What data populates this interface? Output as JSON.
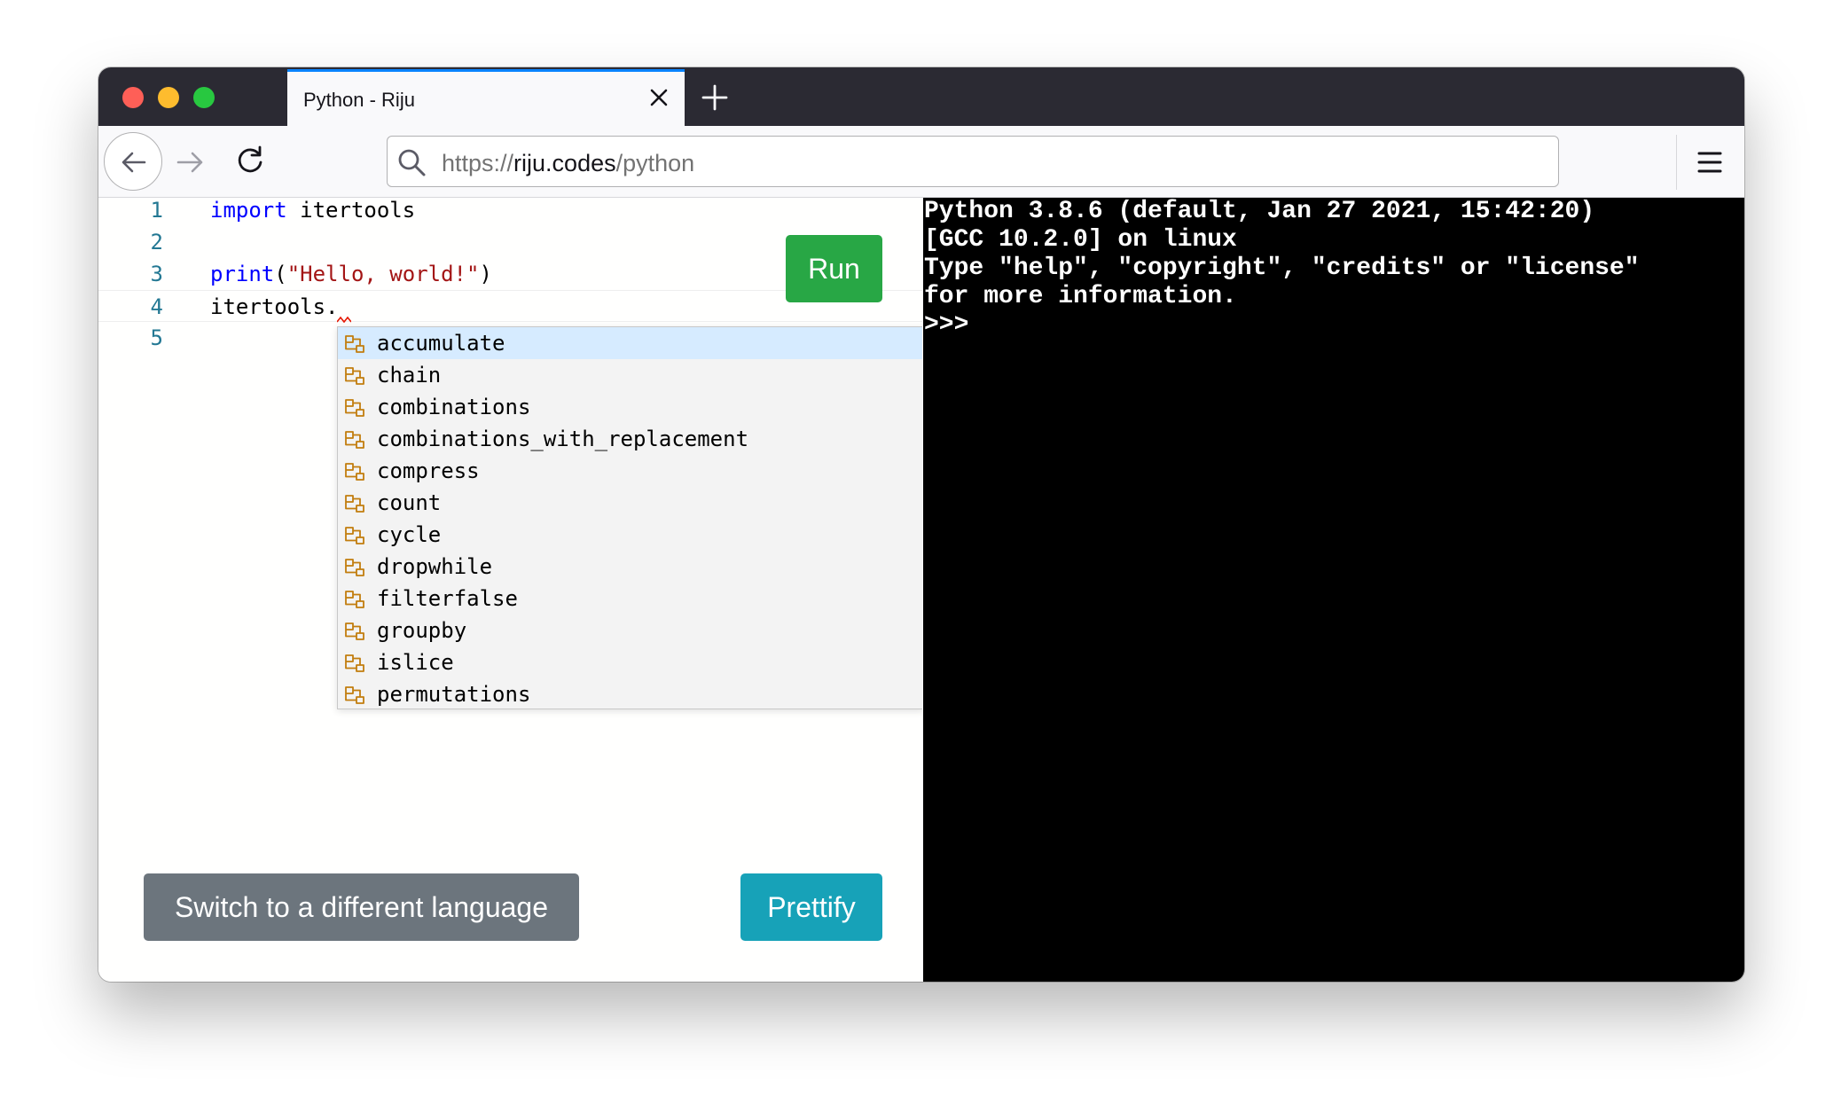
{
  "browser": {
    "tab_title": "Python - Riju",
    "url": {
      "scheme": "https://",
      "host": "riju.codes",
      "path": "/python"
    }
  },
  "editor": {
    "lines": [
      {
        "number": "1",
        "keyword": "import",
        "rest": " itertools"
      },
      {
        "number": "2"
      },
      {
        "number": "3",
        "fn": "print",
        "open": "(",
        "string": "\"Hello, world!\"",
        "close": ")"
      },
      {
        "number": "4",
        "text": "itertools."
      },
      {
        "number": "5"
      }
    ],
    "suggestions": [
      "accumulate",
      "chain",
      "combinations",
      "combinations_with_replacement",
      "compress",
      "count",
      "cycle",
      "dropwhile",
      "filterfalse",
      "groupby",
      "islice",
      "permutations"
    ],
    "suggestion_icon": "function-icon",
    "run_label": "Run",
    "switch_language_label": "Switch to a different language",
    "prettify_label": "Prettify"
  },
  "terminal": {
    "lines": [
      "Python 3.8.6 (default, Jan 27 2021, 15:42:20)",
      "[GCC 10.2.0] on linux",
      "Type \"help\", \"copyright\", \"credits\" or \"license\"",
      "for more information.",
      ">>>"
    ]
  },
  "colors": {
    "run": "#28a745",
    "switch_language": "#6c757d",
    "prettify": "#17a2b8",
    "suggestion_icon": "#c27d0e",
    "active_tab_accent": "#0a84ff"
  }
}
